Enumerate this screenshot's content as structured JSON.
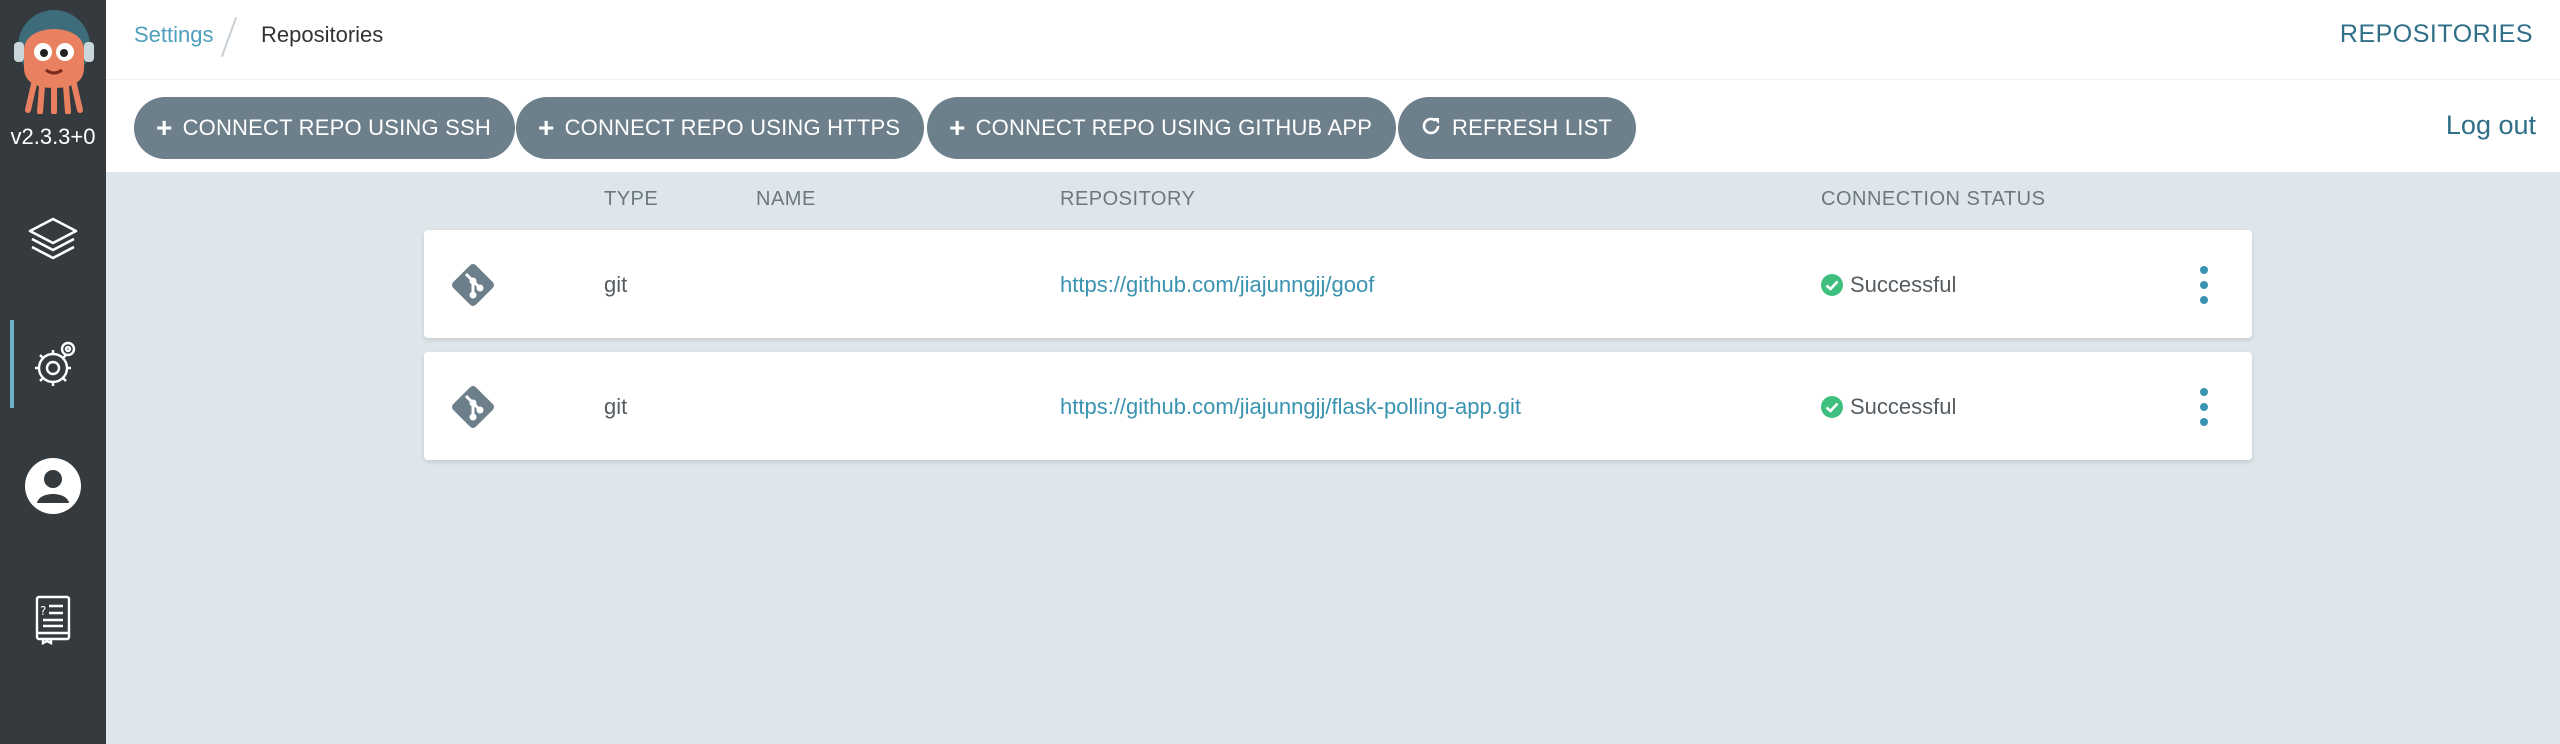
{
  "sidebar": {
    "version": "v2.3.3+0",
    "nav": [
      {
        "icon": "layers-icon",
        "active": false
      },
      {
        "icon": "gear-icon",
        "active": true
      },
      {
        "icon": "user-icon",
        "active": false
      },
      {
        "icon": "docs-icon",
        "active": false
      }
    ]
  },
  "header": {
    "breadcrumb": {
      "parent": "Settings",
      "current": "Repositories"
    },
    "title": "REPOSITORIES"
  },
  "toolbar": {
    "buttons": [
      {
        "icon": "plus-icon",
        "label": "CONNECT REPO USING SSH"
      },
      {
        "icon": "plus-icon",
        "label": "CONNECT REPO USING HTTPS"
      },
      {
        "icon": "plus-icon",
        "label": "CONNECT REPO USING GITHUB APP"
      },
      {
        "icon": "refresh-icon",
        "label": "REFRESH LIST"
      }
    ],
    "logout": "Log out"
  },
  "table": {
    "columns": [
      "TYPE",
      "NAME",
      "REPOSITORY",
      "CONNECTION STATUS"
    ],
    "rows": [
      {
        "type": "git",
        "name": "",
        "repository": "https://github.com/jiajunngjj/goof",
        "status": "Successful"
      },
      {
        "type": "git",
        "name": "",
        "repository": "https://github.com/jiajunngjj/flask-polling-app.git",
        "status": "Successful"
      }
    ]
  },
  "colors": {
    "sidebar_bg": "#353a3e",
    "accent": "#4f9fbc",
    "button_bg": "#6d7f8b",
    "content_bg": "#dee6eb",
    "success": "#3fbf7f"
  }
}
